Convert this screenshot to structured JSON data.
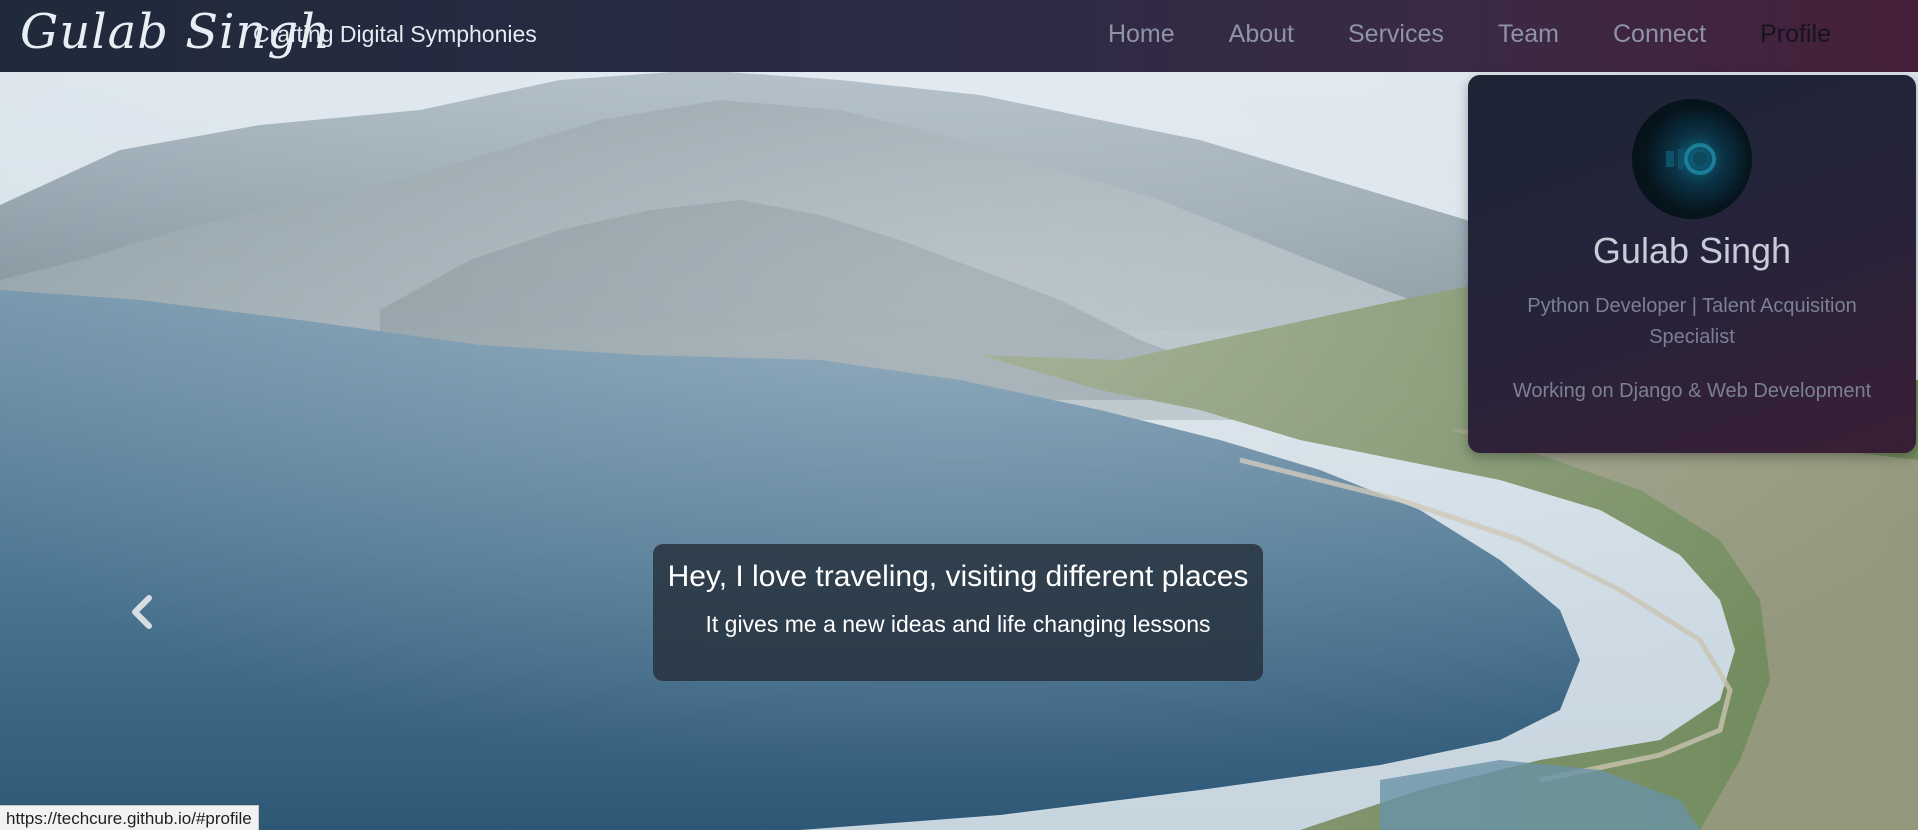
{
  "navbar": {
    "brand": "Gulab Singh",
    "tagline": "Crafting Digital Symphonies",
    "links": [
      {
        "label": "Home"
      },
      {
        "label": "About"
      },
      {
        "label": "Services"
      },
      {
        "label": "Team"
      },
      {
        "label": "Connect"
      },
      {
        "label": "Profile"
      }
    ],
    "active_link": "Profile"
  },
  "profile": {
    "name": "Gulab Singh",
    "role": "Python Developer | Talent Acquisition Specialist",
    "working": "Working on Django & Web Development"
  },
  "carousel": {
    "caption_title": "Hey, I love traveling, visiting different places",
    "caption_subtitle": "It gives me a new ideas and life changing lessons",
    "prev_icon": "chevron-left-icon"
  },
  "status_bar": {
    "url": "https://techcure.github.io/#profile"
  },
  "colors": {
    "nav_bg_start": "#1f2a3a",
    "nav_bg_end": "#46203a",
    "nav_link": "#8e93a8",
    "nav_link_active": "#161320"
  }
}
